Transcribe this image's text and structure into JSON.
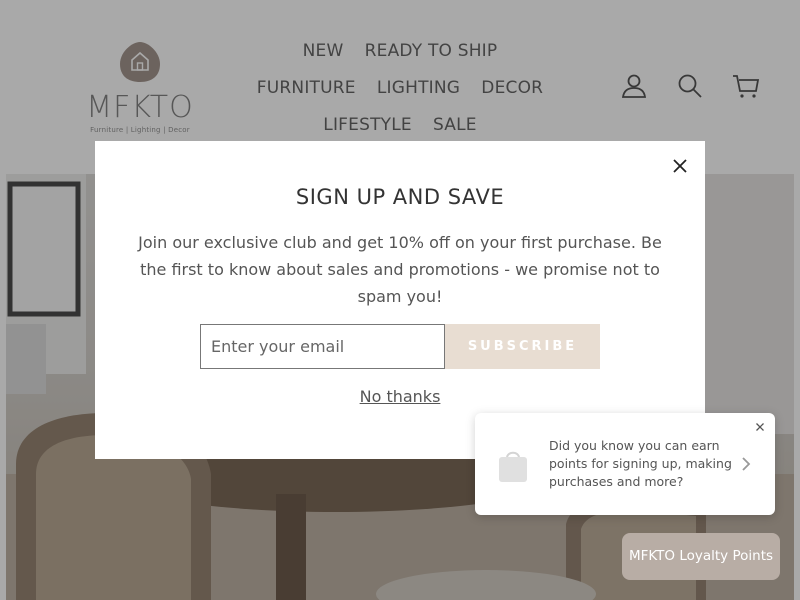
{
  "brand": {
    "name": "MFKTO",
    "tagline": "Furniture | Lighting | Decor"
  },
  "nav": {
    "row1": [
      "NEW",
      "READY TO SHIP"
    ],
    "row2": [
      "FURNITURE",
      "LIGHTING",
      "DECOR"
    ],
    "row3": [
      "LIFESTYLE",
      "SALE"
    ]
  },
  "header_icons": [
    "user-icon",
    "search-icon",
    "cart-icon"
  ],
  "popup": {
    "title": "SIGN UP AND SAVE",
    "body": "Join our exclusive club and get 10% off on your first purchase. Be the first to know about sales and promotions - we promise not to spam you!",
    "email_placeholder": "Enter your email",
    "subscribe_label": "SUBSCRIBE",
    "no_thanks_label": "No thanks"
  },
  "loyalty": {
    "tooltip_text": "Did you know you can earn points for signing up, making purchases and more?",
    "button_label": "MFKTO Loyalty Points"
  },
  "colors": {
    "subscribe_bg": "#e8ddd2",
    "loyalty_bg": "#b8ada5",
    "logo_mark": "#9a8b82"
  }
}
